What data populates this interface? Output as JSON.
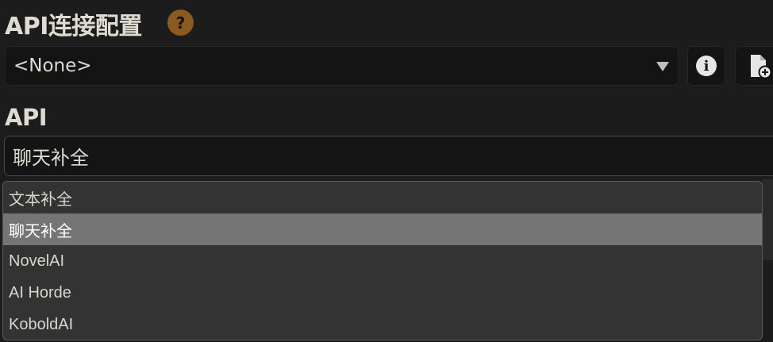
{
  "connection_profile": {
    "title": "API连接配置",
    "help_glyph": "?",
    "selected": "<None>",
    "info_glyph": "i",
    "info_icon": "info-circle-icon",
    "new_icon": "file-plus-icon"
  },
  "api": {
    "title": "API",
    "selected": "聊天补全",
    "options": [
      {
        "label": "文本补全",
        "selected": false
      },
      {
        "label": "聊天补全",
        "selected": true
      },
      {
        "label": "NovelAI",
        "selected": false
      },
      {
        "label": "AI Horde",
        "selected": false
      },
      {
        "label": "KoboldAI",
        "selected": false
      }
    ]
  },
  "colors": {
    "accent_help": "#8a5a20",
    "selected_option_bg": "#757575",
    "dropdown_bg": "#333333"
  }
}
